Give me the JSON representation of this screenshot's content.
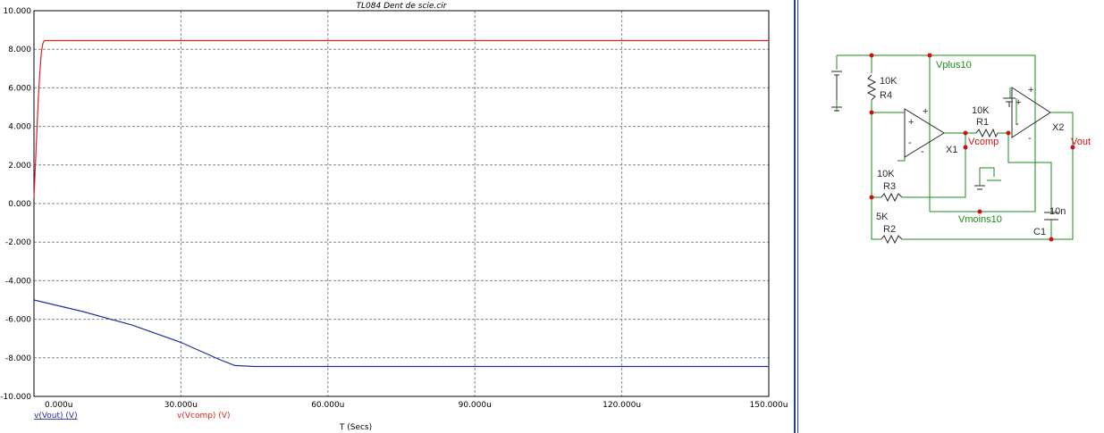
{
  "colors": {
    "vout": "#1f2f9f",
    "vcomp": "#e0201e",
    "grid": "#888888",
    "wire": "#1a8a1a",
    "comp": "#2a2a2a",
    "node": "#d01010"
  },
  "chart_data": {
    "type": "line",
    "title": "TL084 Dent de scie.cir",
    "xlabel": "T (Secs)",
    "ylabel": "",
    "xlim": [
      0,
      150
    ],
    "ylim": [
      -10,
      10
    ],
    "xticks": [
      0,
      30,
      60,
      90,
      120,
      150
    ],
    "xtick_labels": [
      "0.000u",
      "30.000u",
      "60.000u",
      "90.000u",
      "120.000u",
      "150.000u"
    ],
    "yticks": [
      10,
      8,
      6,
      4,
      2,
      0,
      -2,
      -4,
      -6,
      -8,
      -10
    ],
    "ytick_labels": [
      "10.000",
      "8.000",
      "6.000",
      "4.000",
      "2.000",
      "0.000",
      "-2.000",
      "-4.000",
      "-6.000",
      "-8.000",
      "-10.000"
    ],
    "grid": true,
    "series": [
      {
        "name": "v(Vout) (V)",
        "color": "#1f2f9f",
        "x": [
          0,
          10,
          20,
          30,
          38,
          41,
          45,
          60,
          90,
          120,
          150
        ],
        "y": [
          -5.0,
          -5.6,
          -6.3,
          -7.2,
          -8.1,
          -8.4,
          -8.45,
          -8.45,
          -8.45,
          -8.45,
          -8.45
        ]
      },
      {
        "name": "v(Vcomp) (V)",
        "color": "#e0201e",
        "x": [
          0,
          0.3,
          0.6,
          0.9,
          1.2,
          1.5,
          1.8,
          2.1,
          3,
          30,
          60,
          90,
          120,
          150
        ],
        "y": [
          0.3,
          2.0,
          3.8,
          5.5,
          6.8,
          7.8,
          8.3,
          8.45,
          8.45,
          8.45,
          8.45,
          8.45,
          8.45,
          8.45
        ]
      }
    ]
  },
  "schematic": {
    "labels": {
      "r4_value": "10K",
      "r4_name": "R4",
      "r1_value": "10K",
      "r1_name": "R1",
      "r3_value": "10K",
      "r3_name": "R3",
      "r2_value": "5K",
      "r2_name": "R2",
      "c1_value": "10n",
      "c1_name": "C1",
      "vplus": "Vplus10",
      "vmoins": "Vmoins10",
      "vcomp": "Vcomp",
      "vout": "Vout",
      "x1": "X1",
      "x2": "X2"
    }
  }
}
